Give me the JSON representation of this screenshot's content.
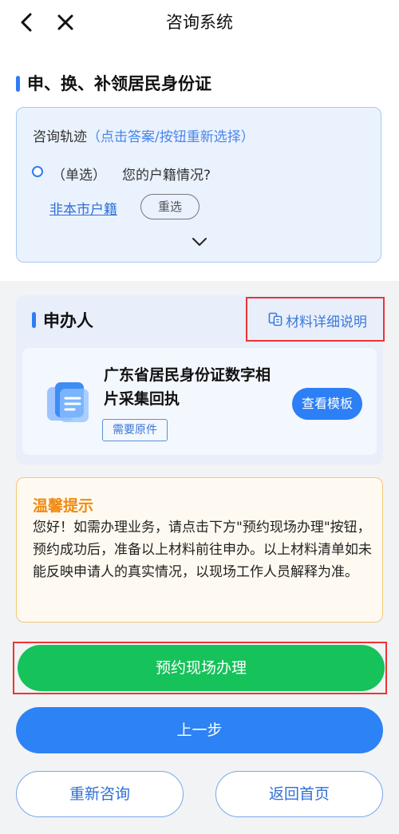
{
  "nav": {
    "title": "咨询系统"
  },
  "section": {
    "title": "申、换、补领居民身份证"
  },
  "track": {
    "label": "咨询轨迹",
    "hint": "（点击答案/按钮重新选择）",
    "question_type": "（单选）",
    "question": "您的户籍情况?",
    "answer": "非本市户籍",
    "reselect": "重选"
  },
  "applicant": {
    "title": "申办人",
    "materials_link": "材料详细说明",
    "doc_title": "广东省居民身份证数字相片采集回执",
    "doc_tag": "需要原件",
    "doc_button": "查看模板"
  },
  "tips": {
    "title": "温馨提示",
    "body": "您好！如需办理业务，请点击下方\"预约现场办理\"按钮，预约成功后，准备以上材料前往申办。以上材料清单如未能反映申请人的真实情况，以现场工作人员解释为准。"
  },
  "buttons": {
    "book": "预约现场办理",
    "prev": "上一步",
    "restart": "重新咨询",
    "home": "返回首页"
  },
  "colors": {
    "primary": "#2d82f5",
    "success": "#16c25a",
    "warning": "#f08a12",
    "highlight": "#e33333"
  }
}
